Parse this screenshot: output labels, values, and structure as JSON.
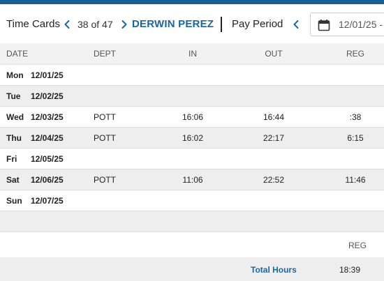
{
  "header": {
    "title": "Time Cards",
    "counter": "38 of 47",
    "employee": "DERWIN PEREZ",
    "pay_period_label": "Pay Period",
    "date_value": "12/01/25 -"
  },
  "columns": {
    "date": "DATE",
    "dept": "DEPT",
    "in": "IN",
    "out": "OUT",
    "reg": "REG"
  },
  "rows": [
    {
      "day": "Mon",
      "date": "12/01/25",
      "dept": "",
      "in": "",
      "out": "",
      "reg": ""
    },
    {
      "day": "Tue",
      "date": "12/02/25",
      "dept": "",
      "in": "",
      "out": "",
      "reg": ""
    },
    {
      "day": "Wed",
      "date": "12/03/25",
      "dept": "POTT",
      "in": "16:06",
      "out": "16:44",
      "reg": ":38"
    },
    {
      "day": "Thu",
      "date": "12/04/25",
      "dept": "POTT",
      "in": "16:02",
      "out": "22:17",
      "reg": "6:15"
    },
    {
      "day": "Fri",
      "date": "12/05/25",
      "dept": "",
      "in": "",
      "out": "",
      "reg": ""
    },
    {
      "day": "Sat",
      "date": "12/06/25",
      "dept": "POTT",
      "in": "11:06",
      "out": "22:52",
      "reg": "11:46"
    },
    {
      "day": "Sun",
      "date": "12/07/25",
      "dept": "",
      "in": "",
      "out": "",
      "reg": ""
    }
  ],
  "summary": {
    "reg_header": "REG",
    "total_label": "Total Hours",
    "total_value": "18:39"
  },
  "colors": {
    "accent": "#1a66a0",
    "topbar": "#1a5e96",
    "shaded_row": "#eeeeee"
  },
  "icons": {
    "prev": "chevron-left-icon",
    "next": "chevron-right-icon",
    "period_prev": "chevron-left-icon",
    "calendar": "calendar-icon"
  }
}
